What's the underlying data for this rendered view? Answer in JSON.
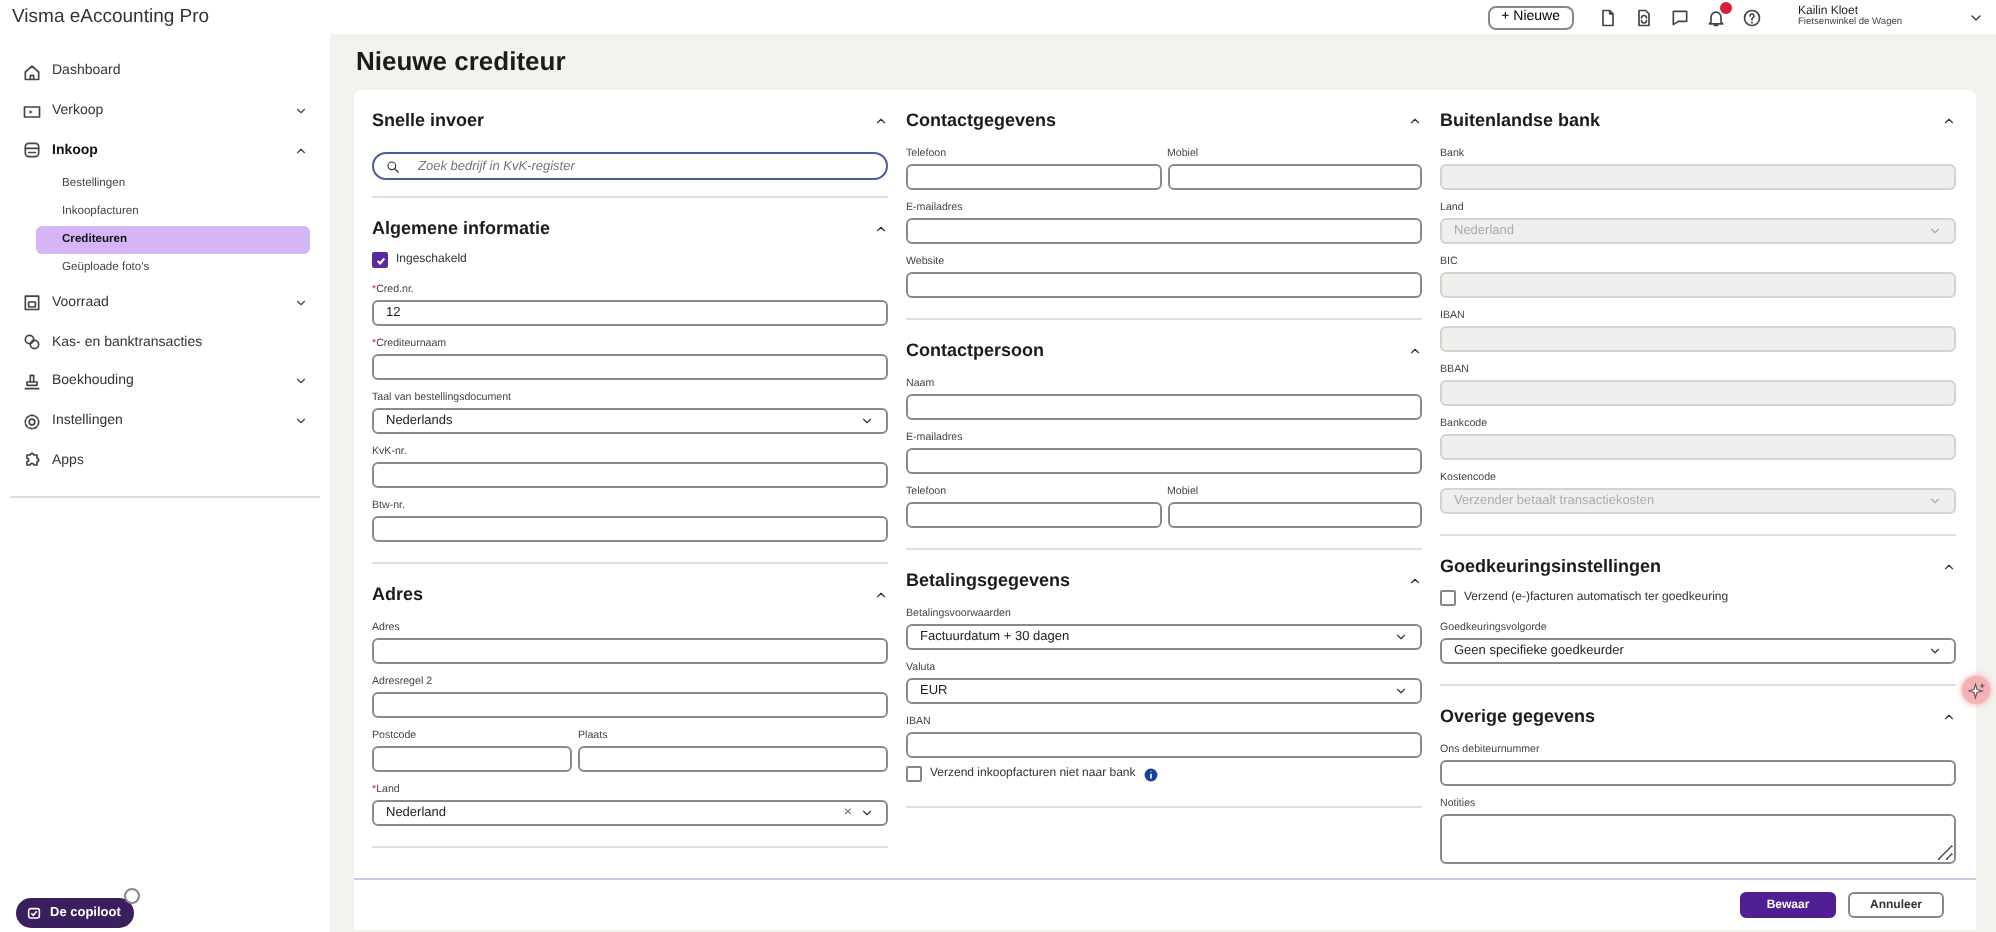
{
  "app": {
    "title": "Visma eAccounting Pro"
  },
  "top_bar": {
    "new_button": "+ Nieuwe",
    "user": {
      "name": "Kailin Kloet",
      "company": "Fietsenwinkel de Wagen"
    }
  },
  "sidebar": {
    "items": [
      {
        "label": "Dashboard",
        "selected": false
      },
      {
        "label": "Verkoop",
        "selected": false,
        "expanded": false
      },
      {
        "label": "Inkoop",
        "selected": false,
        "expanded": true,
        "children": [
          {
            "label": "Bestellingen",
            "selected": false
          },
          {
            "label": "Inkoopfacturen",
            "selected": false
          },
          {
            "label": "Crediteuren",
            "selected": true
          },
          {
            "label": "Geüploade foto's",
            "selected": false
          }
        ]
      },
      {
        "label": "Voorraad",
        "selected": false,
        "expanded": false
      },
      {
        "label": "Kas- en banktransacties",
        "selected": false
      },
      {
        "label": "Boekhouding",
        "selected": false,
        "expanded": false
      },
      {
        "label": "Instellingen",
        "selected": false,
        "expanded": false
      },
      {
        "label": "Apps",
        "selected": false
      }
    ],
    "copilot_button": "De copiloot"
  },
  "page": {
    "title": "Nieuwe crediteur"
  },
  "form": {
    "columns": [
      {
        "sections": [
          {
            "title": "Snelle invoer",
            "expanded": true,
            "fields": [
              {
                "kind": "search",
                "placeholder": "Zoek bedrijf in KvK-register"
              }
            ]
          },
          {
            "title": "Algemene informatie",
            "expanded": true,
            "fields": [
              {
                "kind": "checkbox",
                "label": "Ingeschakeld",
                "checked": true
              },
              {
                "kind": "text",
                "label": "Cred.nr.",
                "required_mark": "*",
                "value": "12"
              },
              {
                "kind": "text",
                "label": "Crediteurnaam",
                "required_mark": "*"
              },
              {
                "kind": "select",
                "label": "Taal van bestellingsdocument",
                "value": "Nederlands"
              },
              {
                "kind": "text",
                "label": "KvK-nr."
              },
              {
                "kind": "text",
                "label": "Btw-nr."
              }
            ]
          },
          {
            "title": "Adres",
            "expanded": true,
            "fields": [
              {
                "kind": "text",
                "label": "Adres"
              },
              {
                "kind": "text",
                "label": "Adresregel 2"
              },
              {
                "kind": "pair",
                "fields": [
                  {
                    "kind": "text",
                    "label": "Postcode"
                  },
                  {
                    "kind": "text",
                    "label": "Plaats"
                  }
                ]
              },
              {
                "kind": "select",
                "label": "Land",
                "required_mark": "*",
                "value": "Nederland",
                "clear_symbol": "×"
              }
            ]
          }
        ]
      },
      {
        "sections": [
          {
            "title": "Contactgegevens",
            "expanded": true,
            "fields": [
              {
                "kind": "pair",
                "fields": [
                  {
                    "kind": "text",
                    "label": "Telefoon"
                  },
                  {
                    "kind": "text",
                    "label": "Mobiel"
                  }
                ]
              },
              {
                "kind": "text",
                "label": "E-mailadres"
              },
              {
                "kind": "text",
                "label": "Website"
              }
            ]
          },
          {
            "title": "Contactpersoon",
            "expanded": true,
            "fields": [
              {
                "kind": "text",
                "label": "Naam"
              },
              {
                "kind": "text",
                "label": "E-mailadres"
              },
              {
                "kind": "pair",
                "fields": [
                  {
                    "kind": "text",
                    "label": "Telefoon"
                  },
                  {
                    "kind": "text",
                    "label": "Mobiel"
                  }
                ]
              }
            ]
          },
          {
            "title": "Betalingsgegevens",
            "expanded": true,
            "fields": [
              {
                "kind": "select",
                "label": "Betalingsvoorwaarden",
                "value": "Factuurdatum + 30 dagen"
              },
              {
                "kind": "select",
                "label": "Valuta",
                "value": "EUR"
              },
              {
                "kind": "text",
                "label": "IBAN"
              },
              {
                "kind": "checkbox",
                "label": "Verzend inkoopfacturen niet naar bank",
                "checked": false,
                "info": true
              }
            ]
          }
        ]
      },
      {
        "sections": [
          {
            "title": "Buitenlandse bank",
            "expanded": true,
            "fields": [
              {
                "kind": "text",
                "label": "Bank",
                "disabled": true
              },
              {
                "kind": "select",
                "label": "Land",
                "value": "Nederland",
                "disabled": true
              },
              {
                "kind": "text",
                "label": "BIC",
                "disabled": true
              },
              {
                "kind": "text",
                "label": "IBAN",
                "disabled": true
              },
              {
                "kind": "text",
                "label": "BBAN",
                "disabled": true
              },
              {
                "kind": "text",
                "label": "Bankcode",
                "disabled": true
              },
              {
                "kind": "select",
                "label": "Kostencode",
                "value": "Verzender betaalt transactiekosten",
                "disabled": true
              }
            ]
          },
          {
            "title": "Goedkeuringsinstellingen",
            "expanded": true,
            "fields": [
              {
                "kind": "checkbox",
                "label": "Verzend (e-)facturen automatisch ter goedkeuring",
                "checked": false
              },
              {
                "kind": "select",
                "label": "Goedkeuringsvolgorde",
                "value": "Geen specifieke goedkeurder"
              }
            ]
          },
          {
            "title": "Overige gegevens",
            "expanded": true,
            "fields": [
              {
                "kind": "text",
                "label": "Ons debiteurnummer"
              },
              {
                "kind": "textarea",
                "label": "Notities"
              }
            ]
          }
        ]
      }
    ],
    "buttons": [
      {
        "label": "Bewaar",
        "kind": "primary"
      },
      {
        "label": "Annuleer",
        "kind": "secondary"
      }
    ]
  }
}
